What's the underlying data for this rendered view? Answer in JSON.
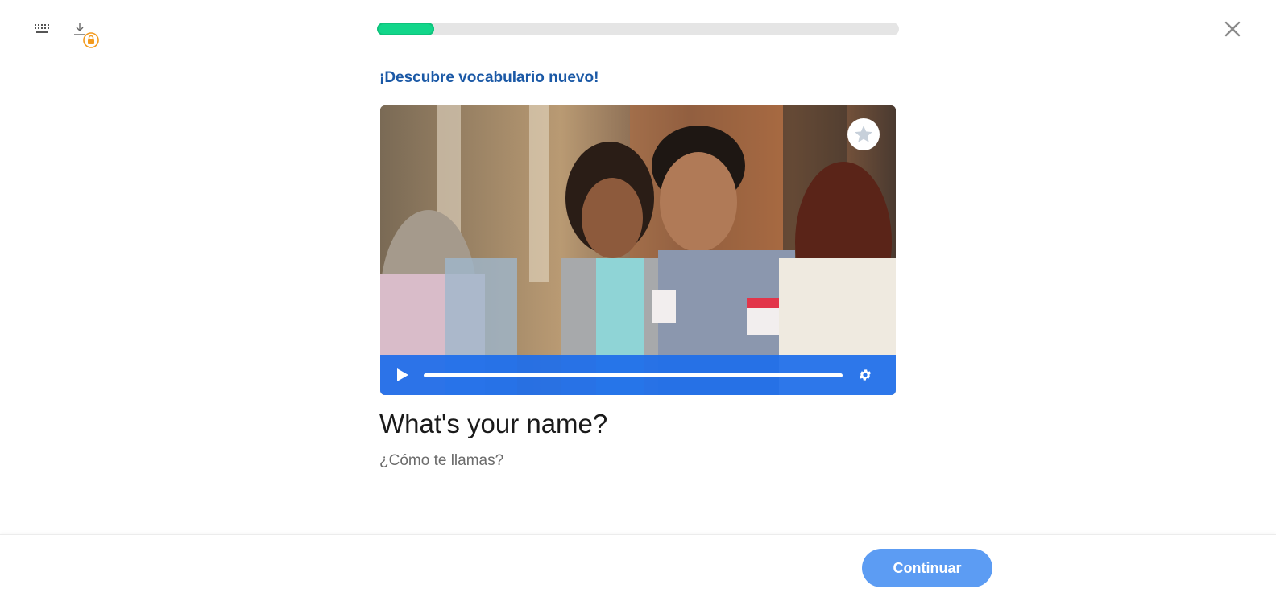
{
  "toolbar": {
    "keyboard_icon": "keyboard-icon",
    "download_icon": "download-locked-icon",
    "close_icon": "close-icon"
  },
  "progress": {
    "value_percent": 11,
    "color": "#12d68a"
  },
  "lesson": {
    "prompt_title": "¡Descubre vocabulario nuevo!",
    "phrase": "What's your name?",
    "translation": "¿Cómo te llamas?"
  },
  "video": {
    "favorite_icon": "star-icon",
    "play_icon": "play-icon",
    "settings_icon": "gear-icon",
    "controls_color": "#1e6eeb"
  },
  "footer": {
    "continue_label": "Continuar",
    "button_color": "#5c9cf3"
  }
}
